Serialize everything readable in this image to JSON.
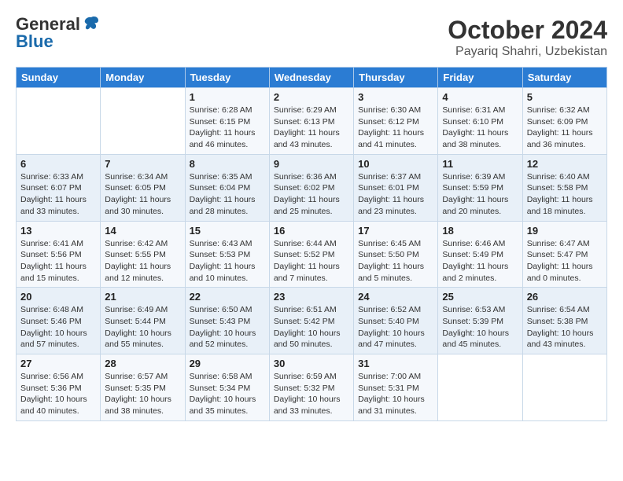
{
  "header": {
    "logo_general": "General",
    "logo_blue": "Blue",
    "month": "October 2024",
    "location": "Payariq Shahri, Uzbekistan"
  },
  "days_of_week": [
    "Sunday",
    "Monday",
    "Tuesday",
    "Wednesday",
    "Thursday",
    "Friday",
    "Saturday"
  ],
  "weeks": [
    [
      {
        "day": "",
        "sunrise": "",
        "sunset": "",
        "daylight": ""
      },
      {
        "day": "",
        "sunrise": "",
        "sunset": "",
        "daylight": ""
      },
      {
        "day": "1",
        "sunrise": "Sunrise: 6:28 AM",
        "sunset": "Sunset: 6:15 PM",
        "daylight": "Daylight: 11 hours and 46 minutes."
      },
      {
        "day": "2",
        "sunrise": "Sunrise: 6:29 AM",
        "sunset": "Sunset: 6:13 PM",
        "daylight": "Daylight: 11 hours and 43 minutes."
      },
      {
        "day": "3",
        "sunrise": "Sunrise: 6:30 AM",
        "sunset": "Sunset: 6:12 PM",
        "daylight": "Daylight: 11 hours and 41 minutes."
      },
      {
        "day": "4",
        "sunrise": "Sunrise: 6:31 AM",
        "sunset": "Sunset: 6:10 PM",
        "daylight": "Daylight: 11 hours and 38 minutes."
      },
      {
        "day": "5",
        "sunrise": "Sunrise: 6:32 AM",
        "sunset": "Sunset: 6:09 PM",
        "daylight": "Daylight: 11 hours and 36 minutes."
      }
    ],
    [
      {
        "day": "6",
        "sunrise": "Sunrise: 6:33 AM",
        "sunset": "Sunset: 6:07 PM",
        "daylight": "Daylight: 11 hours and 33 minutes."
      },
      {
        "day": "7",
        "sunrise": "Sunrise: 6:34 AM",
        "sunset": "Sunset: 6:05 PM",
        "daylight": "Daylight: 11 hours and 30 minutes."
      },
      {
        "day": "8",
        "sunrise": "Sunrise: 6:35 AM",
        "sunset": "Sunset: 6:04 PM",
        "daylight": "Daylight: 11 hours and 28 minutes."
      },
      {
        "day": "9",
        "sunrise": "Sunrise: 6:36 AM",
        "sunset": "Sunset: 6:02 PM",
        "daylight": "Daylight: 11 hours and 25 minutes."
      },
      {
        "day": "10",
        "sunrise": "Sunrise: 6:37 AM",
        "sunset": "Sunset: 6:01 PM",
        "daylight": "Daylight: 11 hours and 23 minutes."
      },
      {
        "day": "11",
        "sunrise": "Sunrise: 6:39 AM",
        "sunset": "Sunset: 5:59 PM",
        "daylight": "Daylight: 11 hours and 20 minutes."
      },
      {
        "day": "12",
        "sunrise": "Sunrise: 6:40 AM",
        "sunset": "Sunset: 5:58 PM",
        "daylight": "Daylight: 11 hours and 18 minutes."
      }
    ],
    [
      {
        "day": "13",
        "sunrise": "Sunrise: 6:41 AM",
        "sunset": "Sunset: 5:56 PM",
        "daylight": "Daylight: 11 hours and 15 minutes."
      },
      {
        "day": "14",
        "sunrise": "Sunrise: 6:42 AM",
        "sunset": "Sunset: 5:55 PM",
        "daylight": "Daylight: 11 hours and 12 minutes."
      },
      {
        "day": "15",
        "sunrise": "Sunrise: 6:43 AM",
        "sunset": "Sunset: 5:53 PM",
        "daylight": "Daylight: 11 hours and 10 minutes."
      },
      {
        "day": "16",
        "sunrise": "Sunrise: 6:44 AM",
        "sunset": "Sunset: 5:52 PM",
        "daylight": "Daylight: 11 hours and 7 minutes."
      },
      {
        "day": "17",
        "sunrise": "Sunrise: 6:45 AM",
        "sunset": "Sunset: 5:50 PM",
        "daylight": "Daylight: 11 hours and 5 minutes."
      },
      {
        "day": "18",
        "sunrise": "Sunrise: 6:46 AM",
        "sunset": "Sunset: 5:49 PM",
        "daylight": "Daylight: 11 hours and 2 minutes."
      },
      {
        "day": "19",
        "sunrise": "Sunrise: 6:47 AM",
        "sunset": "Sunset: 5:47 PM",
        "daylight": "Daylight: 11 hours and 0 minutes."
      }
    ],
    [
      {
        "day": "20",
        "sunrise": "Sunrise: 6:48 AM",
        "sunset": "Sunset: 5:46 PM",
        "daylight": "Daylight: 10 hours and 57 minutes."
      },
      {
        "day": "21",
        "sunrise": "Sunrise: 6:49 AM",
        "sunset": "Sunset: 5:44 PM",
        "daylight": "Daylight: 10 hours and 55 minutes."
      },
      {
        "day": "22",
        "sunrise": "Sunrise: 6:50 AM",
        "sunset": "Sunset: 5:43 PM",
        "daylight": "Daylight: 10 hours and 52 minutes."
      },
      {
        "day": "23",
        "sunrise": "Sunrise: 6:51 AM",
        "sunset": "Sunset: 5:42 PM",
        "daylight": "Daylight: 10 hours and 50 minutes."
      },
      {
        "day": "24",
        "sunrise": "Sunrise: 6:52 AM",
        "sunset": "Sunset: 5:40 PM",
        "daylight": "Daylight: 10 hours and 47 minutes."
      },
      {
        "day": "25",
        "sunrise": "Sunrise: 6:53 AM",
        "sunset": "Sunset: 5:39 PM",
        "daylight": "Daylight: 10 hours and 45 minutes."
      },
      {
        "day": "26",
        "sunrise": "Sunrise: 6:54 AM",
        "sunset": "Sunset: 5:38 PM",
        "daylight": "Daylight: 10 hours and 43 minutes."
      }
    ],
    [
      {
        "day": "27",
        "sunrise": "Sunrise: 6:56 AM",
        "sunset": "Sunset: 5:36 PM",
        "daylight": "Daylight: 10 hours and 40 minutes."
      },
      {
        "day": "28",
        "sunrise": "Sunrise: 6:57 AM",
        "sunset": "Sunset: 5:35 PM",
        "daylight": "Daylight: 10 hours and 38 minutes."
      },
      {
        "day": "29",
        "sunrise": "Sunrise: 6:58 AM",
        "sunset": "Sunset: 5:34 PM",
        "daylight": "Daylight: 10 hours and 35 minutes."
      },
      {
        "day": "30",
        "sunrise": "Sunrise: 6:59 AM",
        "sunset": "Sunset: 5:32 PM",
        "daylight": "Daylight: 10 hours and 33 minutes."
      },
      {
        "day": "31",
        "sunrise": "Sunrise: 7:00 AM",
        "sunset": "Sunset: 5:31 PM",
        "daylight": "Daylight: 10 hours and 31 minutes."
      },
      {
        "day": "",
        "sunrise": "",
        "sunset": "",
        "daylight": ""
      },
      {
        "day": "",
        "sunrise": "",
        "sunset": "",
        "daylight": ""
      }
    ]
  ]
}
